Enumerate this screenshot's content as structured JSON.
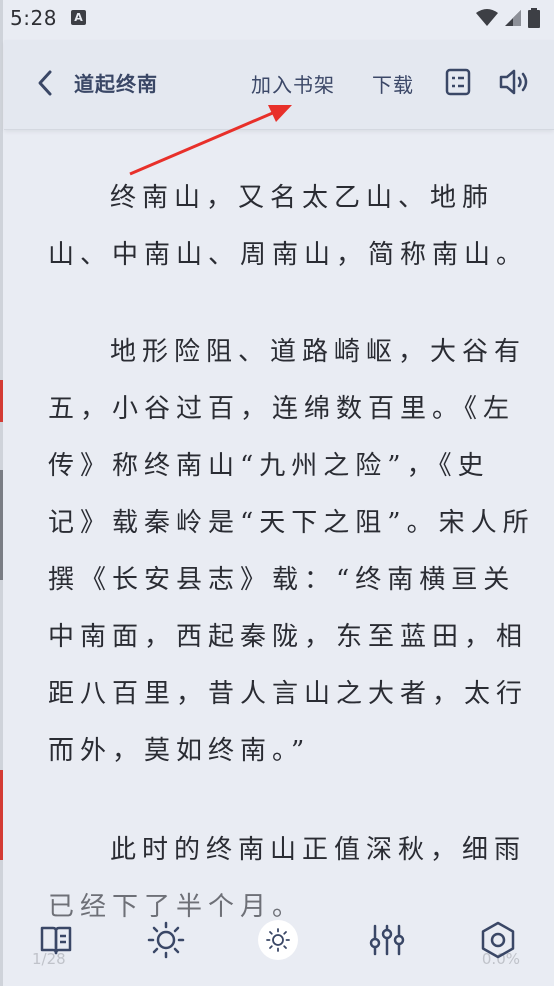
{
  "status": {
    "time": "5:28",
    "badge": "A"
  },
  "header": {
    "title": "道起终南",
    "add_to_shelf": "加入书架",
    "download": "下载"
  },
  "content": {
    "paragraphs": [
      [
        "终南山，又名太乙山、地肺",
        "山、中南山、周南山，简称南山。"
      ],
      [
        "地形险阻、道路崎岖，大谷有",
        "五，小谷过百，连绵数百里。《左",
        "传》称终南山“九州之险”，《史",
        "记》载秦岭是“天下之阻”。宋人所",
        "撰《长安县志》载：“终南横亘关",
        "中南面，西起秦陇，东至蓝田，相",
        "距八百里，昔人言山之大者，太行",
        "而外，莫如终南。”"
      ],
      [
        "此时的终南山正值深秋，细雨",
        "已经下了半个月。"
      ]
    ]
  },
  "footer": {
    "page": "1/28",
    "progress": "0.0%"
  },
  "colors": {
    "background": "#e9ecf3",
    "accent": "#3a4766",
    "arrow": "#e8302a"
  },
  "icons": [
    "back-chevron-icon",
    "toc-icon",
    "speaker-icon",
    "book-icon",
    "brightness-icon",
    "brightness-low-icon",
    "sliders-icon",
    "settings-hexagon-icon",
    "wifi-icon",
    "signal-icon",
    "battery-icon"
  ]
}
